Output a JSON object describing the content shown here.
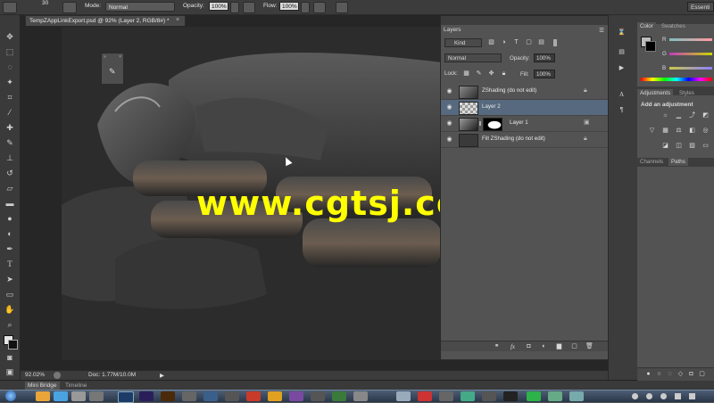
{
  "options_bar": {
    "brush_size": "30",
    "mode_label": "Mode:",
    "mode_value": "Normal",
    "opacity_label": "Opacity:",
    "opacity_value": "100%",
    "flow_label": "Flow:",
    "flow_value": "100%",
    "workspace": "Essenti"
  },
  "document": {
    "tab_title": "TempZAppLinkExport.psd @ 92% (Layer 2, RGB/8#) *",
    "tab_close": "×",
    "watermark": "www.cgtsj.com"
  },
  "status_bar": {
    "zoom": "92.02%",
    "doc_info": "Doc: 1.77M/10.0M"
  },
  "bottom_tabs": [
    "Mini Bridge",
    "Timeline"
  ],
  "layers_panel": {
    "title": "Layers",
    "filter_kind": "Kind",
    "blend_mode": "Normal",
    "opacity_label": "Opacity:",
    "opacity_value": "100%",
    "lock_label": "Lock:",
    "fill_label": "Fill:",
    "fill_value": "100%",
    "layers": [
      {
        "name": "ZShading (do not edit)",
        "selected": false,
        "locked": true
      },
      {
        "name": "Layer 2",
        "selected": true,
        "locked": false
      },
      {
        "name": "Layer 1",
        "selected": false,
        "locked": false
      },
      {
        "name": "Fill ZShading (do not edit)",
        "selected": false,
        "locked": true
      }
    ]
  },
  "color_panel": {
    "tabs": [
      "Color",
      "Swatches"
    ],
    "channels": [
      "R",
      "G",
      "B"
    ]
  },
  "adjustments_panel": {
    "tabs": [
      "Adjustments",
      "Styles"
    ],
    "heading": "Add an adjustment"
  },
  "paths_panel": {
    "tabs": [
      "Channels",
      "Paths"
    ]
  }
}
